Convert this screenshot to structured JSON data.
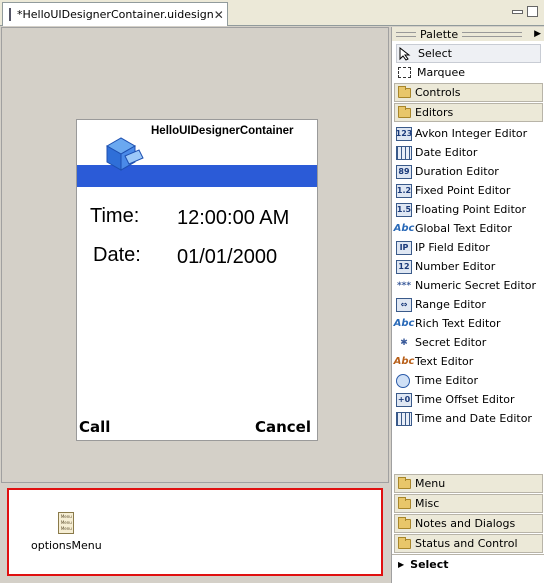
{
  "editor_tab": {
    "title": "*HelloUIDesignerContainer.uidesign",
    "close_glyph": "✕"
  },
  "phone": {
    "title": "HelloUIDesignerContainer",
    "form": {
      "time_label": "Time:",
      "time_value": "12:00:00 AM",
      "date_label": "Date:",
      "date_value": "01/01/2000"
    },
    "softkeys": {
      "left": "Call",
      "right": "Cancel"
    }
  },
  "non_visual": {
    "items": [
      {
        "label": "optionsMenu",
        "icon": "menu-icon",
        "icon_text": "Menu Menu Menu"
      }
    ]
  },
  "palette": {
    "header": "Palette",
    "tools": [
      {
        "label": "Select",
        "icon": "cursor-icon"
      },
      {
        "label": "Marquee",
        "icon": "marquee-icon"
      }
    ],
    "drawers_top": [
      {
        "label": "Controls"
      },
      {
        "label": "Editors"
      }
    ],
    "editors": [
      {
        "label": "Avkon Integer Editor",
        "icon": "integer-icon",
        "glyph": "123"
      },
      {
        "label": "Date Editor",
        "icon": "date-icon",
        "glyph": "▦"
      },
      {
        "label": "Duration Editor",
        "icon": "duration-icon",
        "glyph": "89"
      },
      {
        "label": "Fixed Point Editor",
        "icon": "fixed-point-icon",
        "glyph": "1.2"
      },
      {
        "label": "Floating Point Editor",
        "icon": "floating-point-icon",
        "glyph": "1.5"
      },
      {
        "label": "Global Text Editor",
        "icon": "global-text-icon",
        "glyph": "Abc"
      },
      {
        "label": "IP Field Editor",
        "icon": "ip-field-icon",
        "glyph": "IP"
      },
      {
        "label": "Number Editor",
        "icon": "number-icon",
        "glyph": "12"
      },
      {
        "label": "Numeric Secret Editor",
        "icon": "numeric-secret-icon",
        "glyph": "***"
      },
      {
        "label": "Range Editor",
        "icon": "range-icon",
        "glyph": "⇔"
      },
      {
        "label": "Rich Text Editor",
        "icon": "rich-text-icon",
        "glyph": "Abc"
      },
      {
        "label": "Secret Editor",
        "icon": "secret-icon",
        "glyph": "✱"
      },
      {
        "label": "Text Editor",
        "icon": "text-icon",
        "glyph": "Abc"
      },
      {
        "label": "Time Editor",
        "icon": "time-icon",
        "glyph": ""
      },
      {
        "label": "Time Offset Editor",
        "icon": "time-offset-icon",
        "glyph": "+0"
      },
      {
        "label": "Time and Date Editor",
        "icon": "time-date-icon",
        "glyph": ""
      }
    ],
    "drawers_bottom": [
      {
        "label": "Menu"
      },
      {
        "label": "Misc"
      },
      {
        "label": "Notes and Dialogs"
      },
      {
        "label": "Status and Control"
      }
    ],
    "status": "Select"
  },
  "colors": {
    "title_pane_blue": "#2b5bd7",
    "selection_red": "#e01010"
  }
}
